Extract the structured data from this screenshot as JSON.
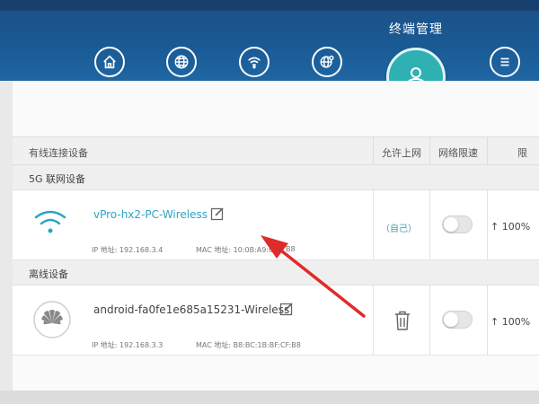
{
  "nav": {
    "active_title": "终端管理",
    "icons": [
      "home-icon",
      "globe-icon",
      "wifi-icon",
      "globe-settings-icon",
      "menu-icon"
    ],
    "active_icon": "user-icon"
  },
  "table": {
    "headers": {
      "device": "有线连接设备",
      "allow_internet": "允许上网",
      "speed_limit": "网络限速",
      "limit_partial": "限"
    }
  },
  "sections": {
    "online": "5G 联网设备",
    "offline": "离线设备"
  },
  "devices": [
    {
      "name": "vPro-hx2-PC-Wireless",
      "ip": "IP 地址: 192.168.3.4",
      "mac": "MAC 地址: 10:0B:A9:6",
      "mac_tail": "B8",
      "allow": "（自己）",
      "speed": "↑ 100%",
      "icon": "wifi-signal-icon"
    },
    {
      "name": "android-fa0fe1e685a15231-Wireless",
      "ip": "IP 地址: 192.168.3.3",
      "mac": "MAC 地址: B8:BC:1B:BF:CF:B8",
      "speed": "↑ 100%",
      "icon": "huawei-logo-icon"
    }
  ],
  "colors": {
    "header_blue": "#1a5b95",
    "accent_teal": "#2fb1b3",
    "arrow_red": "#e02b2b"
  }
}
